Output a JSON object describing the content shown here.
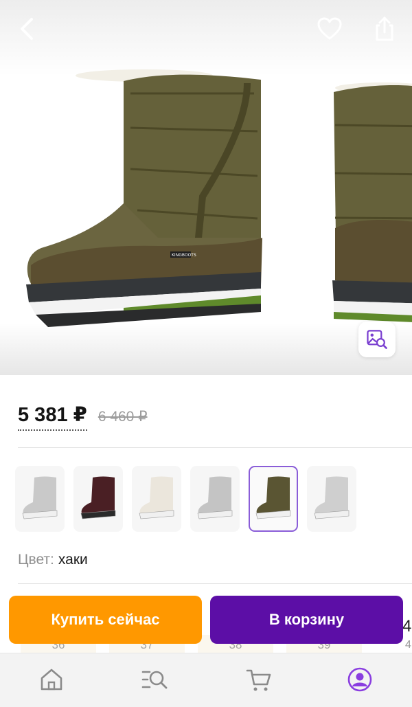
{
  "product": {
    "price": "5 381 ₽",
    "old_price": "6 460 ₽",
    "color_label": "Цвет:",
    "color_value": "хаки",
    "variants": [
      {
        "color": "#c9c9c9"
      },
      {
        "color": "#4a1f24"
      },
      {
        "color": "#ebe6dc"
      },
      {
        "color": "#c4c4c4"
      },
      {
        "color": "#5a5533"
      },
      {
        "color": "#cfcfcf"
      }
    ],
    "selected_variant": 4
  },
  "boot_logo_text": "KINGBOOTS",
  "sizes": [
    "36",
    "37",
    "38",
    "39"
  ],
  "sizes_extra": [
    "4",
    "4"
  ],
  "actions": {
    "buy_now": "Купить сейчас",
    "add_to_cart": "В корзину"
  },
  "colors": {
    "buy_now": "#ff9800",
    "add_to_cart": "#5c0ea6",
    "active_tab": "#8a3ee0"
  },
  "icons": {
    "back": "chevron-left-icon",
    "favorite": "heart-icon",
    "share": "share-icon",
    "photo_search": "image-search-icon",
    "tabs": [
      "home-icon",
      "catalog-search-icon",
      "cart-icon",
      "profile-icon"
    ]
  }
}
